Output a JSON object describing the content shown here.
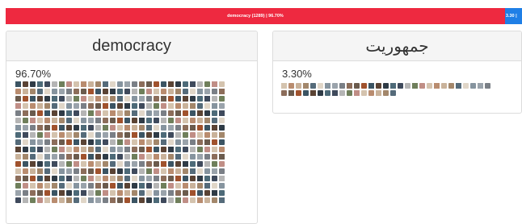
{
  "progress": {
    "segments": [
      {
        "label": "democracy (1289) | 96.70%",
        "share": 96.7,
        "color": "#ee2940"
      },
      {
        "label": "3.30 |",
        "share": 3.3,
        "color": "#1f7fe6"
      }
    ]
  },
  "panels": [
    {
      "title": "democracy",
      "percent": "96.70%",
      "thumbnail_count": 493
    },
    {
      "title": "جمهوریت",
      "percent": "3.30%",
      "thumbnail_count": 45
    }
  ],
  "colors": {
    "accent_red": "#ee2940",
    "accent_blue": "#1f7fe6",
    "panel_header_bg": "#f5f5f5",
    "panel_border": "#dcdcdc",
    "text": "#333333"
  }
}
